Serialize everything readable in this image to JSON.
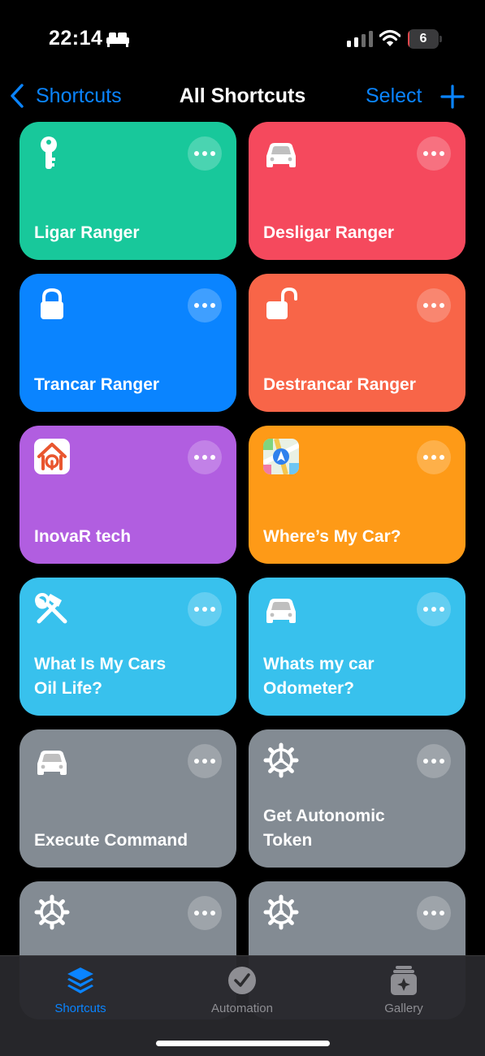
{
  "status_bar": {
    "time": "22:14",
    "battery_level": "6",
    "battery_fraction": 0.06,
    "icons": [
      "bed-icon",
      "cellular-signal-icon",
      "wifi-icon",
      "battery-icon"
    ]
  },
  "nav": {
    "back_label": "Shortcuts",
    "title": "All Shortcuts",
    "select_label": "Select",
    "add_icon": "plus-icon",
    "accent": "#0a84ff"
  },
  "shortcuts": [
    {
      "label": "Ligar Ranger",
      "icon": "key-icon",
      "color": "#18c89b"
    },
    {
      "label": "Desligar Ranger",
      "icon": "car-icon",
      "color": "#f5495d"
    },
    {
      "label": "Trancar Ranger",
      "icon": "lock-icon",
      "color": "#0a84ff"
    },
    {
      "label": "Destrancar Ranger",
      "icon": "unlock-icon",
      "color": "#f86548"
    },
    {
      "label": "InovaR tech",
      "icon": "inovar-app-icon",
      "color": "#b15ee0"
    },
    {
      "label": "Where’s My Car?",
      "icon": "maps-app-icon",
      "color": "#fe9a17"
    },
    {
      "label": "What Is My Cars\nOil Life?",
      "icon": "hammer-wrench-icon",
      "color": "#38c1ed"
    },
    {
      "label": "Whats my car\nOdometer?",
      "icon": "car-icon",
      "color": "#38c1ed"
    },
    {
      "label": "Execute Command",
      "icon": "car-icon",
      "color": "#838b93"
    },
    {
      "label": "Get Autonomic\nToken",
      "icon": "gear-icon",
      "color": "#838b93"
    },
    {
      "label": "",
      "icon": "gear-icon",
      "color": "#838b93"
    },
    {
      "label": "",
      "icon": "gear-icon",
      "color": "#838b93"
    }
  ],
  "tab_bar": {
    "tabs": [
      {
        "label": "Shortcuts",
        "icon": "shortcuts-stack-icon",
        "active": true
      },
      {
        "label": "Automation",
        "icon": "clock-check-icon",
        "active": false
      },
      {
        "label": "Gallery",
        "icon": "gallery-sparkle-icon",
        "active": false
      }
    ]
  }
}
